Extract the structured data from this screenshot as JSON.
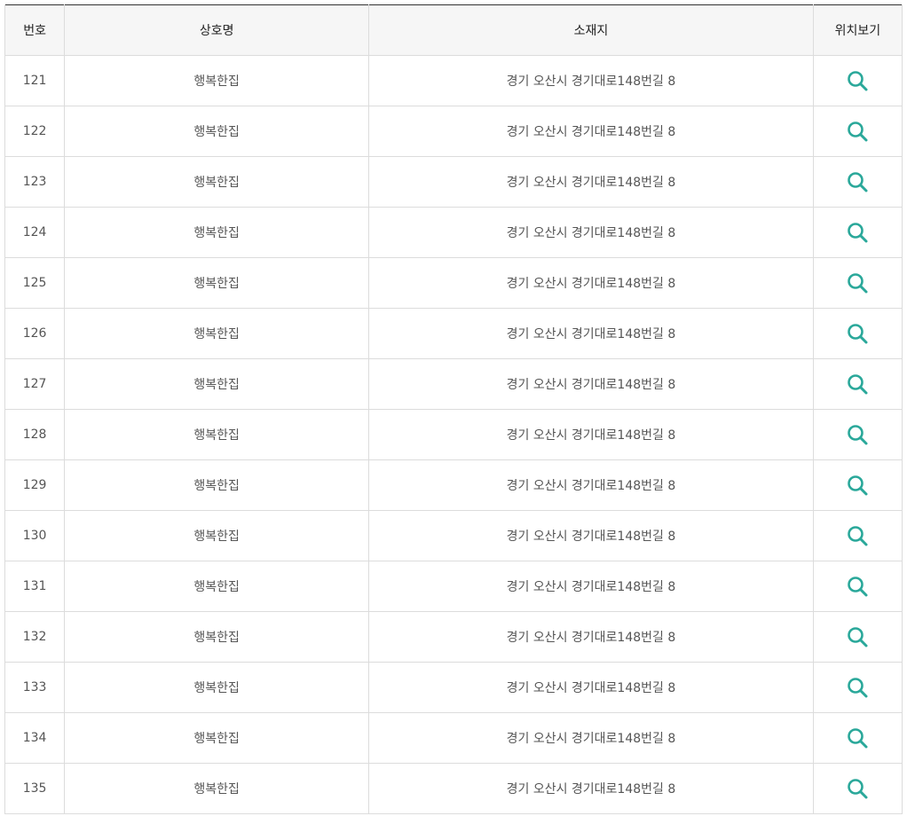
{
  "colors": {
    "accent": "#2aa89a",
    "header_bg": "#f6f6f6",
    "border": "#dcdcdc"
  },
  "table": {
    "headers": {
      "num": "번호",
      "name": "상호명",
      "address": "소재지",
      "location": "위치보기"
    },
    "location_icon": "search-icon",
    "rows": [
      {
        "num": "121",
        "name": "행복한집",
        "address": "경기 오산시 경기대로148번길 8"
      },
      {
        "num": "122",
        "name": "행복한집",
        "address": "경기 오산시 경기대로148번길 8"
      },
      {
        "num": "123",
        "name": "행복한집",
        "address": "경기 오산시 경기대로148번길 8"
      },
      {
        "num": "124",
        "name": "행복한집",
        "address": "경기 오산시 경기대로148번길 8"
      },
      {
        "num": "125",
        "name": "행복한집",
        "address": "경기 오산시 경기대로148번길 8"
      },
      {
        "num": "126",
        "name": "행복한집",
        "address": "경기 오산시 경기대로148번길 8"
      },
      {
        "num": "127",
        "name": "행복한집",
        "address": "경기 오산시 경기대로148번길 8"
      },
      {
        "num": "128",
        "name": "행복한집",
        "address": "경기 오산시 경기대로148번길 8"
      },
      {
        "num": "129",
        "name": "행복한집",
        "address": "경기 오산시 경기대로148번길 8"
      },
      {
        "num": "130",
        "name": "행복한집",
        "address": "경기 오산시 경기대로148번길 8"
      },
      {
        "num": "131",
        "name": "행복한집",
        "address": "경기 오산시 경기대로148번길 8"
      },
      {
        "num": "132",
        "name": "행복한집",
        "address": "경기 오산시 경기대로148번길 8"
      },
      {
        "num": "133",
        "name": "행복한집",
        "address": "경기 오산시 경기대로148번길 8"
      },
      {
        "num": "134",
        "name": "행복한집",
        "address": "경기 오산시 경기대로148번길 8"
      },
      {
        "num": "135",
        "name": "행복한집",
        "address": "경기 오산시 경기대로148번길 8"
      }
    ]
  }
}
